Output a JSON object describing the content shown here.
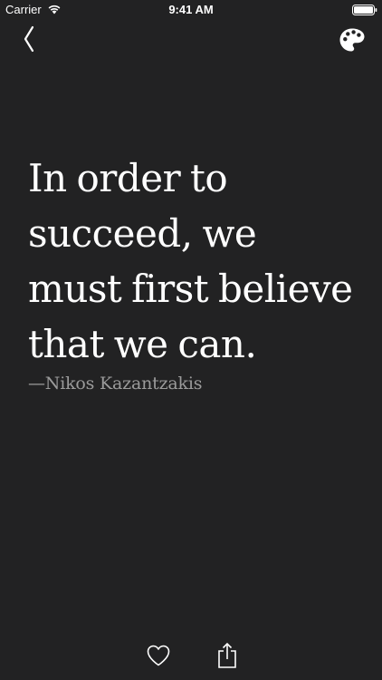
{
  "status_bar": {
    "carrier": "Carrier",
    "time": "9:41 AM"
  },
  "nav": {
    "back_icon": "chevron-left-icon",
    "theme_icon": "palette-icon"
  },
  "quote": {
    "text": "In order to succeed, we must first believe that we can.",
    "author": "—Nikos Kazantzakis"
  },
  "toolbar": {
    "favorite_icon": "heart-icon",
    "share_icon": "share-icon"
  },
  "colors": {
    "background": "#222223",
    "text": "#ffffff",
    "author": "#9b9b9b"
  }
}
